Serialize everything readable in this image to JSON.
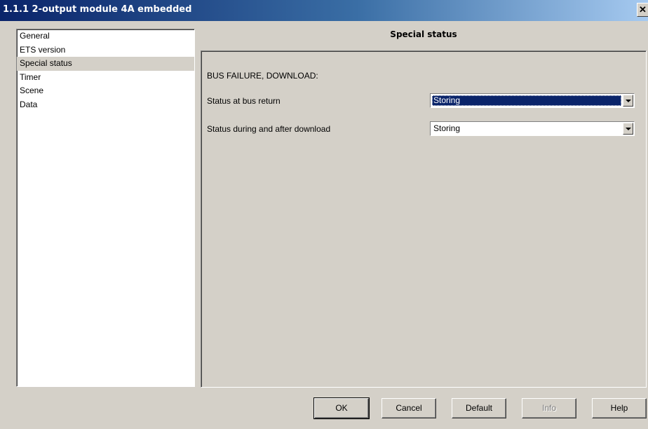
{
  "window": {
    "title": "1.1.1 2-output module 4A embedded",
    "close_glyph": "✕"
  },
  "nav": {
    "items": [
      {
        "label": "General",
        "selected": false
      },
      {
        "label": "ETS version",
        "selected": false
      },
      {
        "label": "Special status",
        "selected": true
      },
      {
        "label": "Timer",
        "selected": false
      },
      {
        "label": "Scene",
        "selected": false
      },
      {
        "label": "Data",
        "selected": false
      }
    ]
  },
  "panel": {
    "title": "Special status",
    "section_heading": "BUS FAILURE, DOWNLOAD:",
    "params": [
      {
        "label": "Status at bus return",
        "value": "Storing",
        "focused": true
      },
      {
        "label": "Status during and after download",
        "value": "Storing",
        "focused": false
      }
    ]
  },
  "buttons": {
    "ok": "OK",
    "cancel": "Cancel",
    "default": "Default",
    "info": "Info",
    "help": "Help"
  },
  "icons": {
    "close": "close-icon",
    "dropdown": "chevron-down-icon"
  },
  "colors": {
    "title_bar": "#0a246a",
    "selection": "#0a246a",
    "face": "#d4d0c8"
  }
}
